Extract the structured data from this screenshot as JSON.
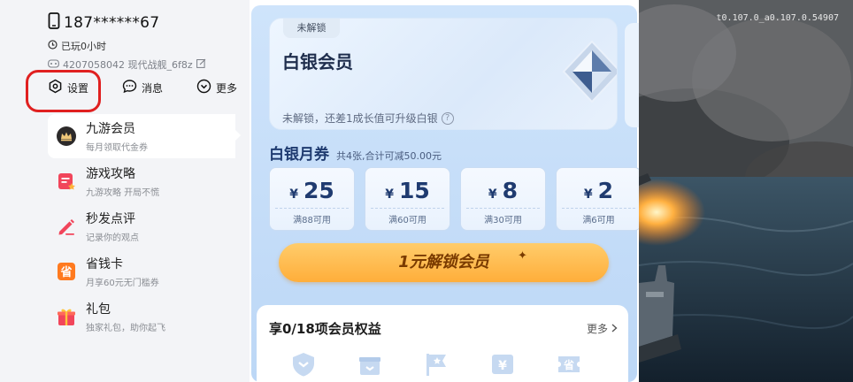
{
  "user": {
    "phone": "187******67",
    "played": "已玩0小时",
    "id_text": "4207058042  现代战舰_6f8z"
  },
  "actions": {
    "settings": "设置",
    "messages": "消息",
    "more": "更多"
  },
  "menu": [
    {
      "title": "九游会员",
      "sub": "每月领取代金券",
      "icon": "crown-icon"
    },
    {
      "title": "游戏攻略",
      "sub": "九游攻略 开局不慌",
      "icon": "guide-icon"
    },
    {
      "title": "秒发点评",
      "sub": "记录你的观点",
      "icon": "pen-icon"
    },
    {
      "title": "省钱卡",
      "sub": "月享60元无门槛券",
      "icon": "saving-card-icon"
    },
    {
      "title": "礼包",
      "sub": "独家礼包，助你起飞",
      "icon": "gift-icon"
    }
  ],
  "membership": {
    "locked_tag": "未解锁",
    "level_name": "白银会员",
    "note": "未解锁，还差1成长值可升级白银",
    "coupon_title": "白银月券",
    "coupon_sub": "共4张,合计可减50.00元",
    "coupons": [
      {
        "currency": "¥",
        "amount": "25",
        "cond": "满88可用"
      },
      {
        "currency": "¥",
        "amount": "15",
        "cond": "满60可用"
      },
      {
        "currency": "¥",
        "amount": "8",
        "cond": "满30可用"
      },
      {
        "currency": "¥",
        "amount": "2",
        "cond": "满6可用"
      }
    ],
    "unlock_label": "1元解锁会员",
    "benefits_title": "享0/18项会员权益",
    "benefits_more": "更多"
  },
  "game": {
    "version": "t0.107.0_a0.107.0.54907"
  },
  "colors": {
    "highlight_ring": "#e02020",
    "unlock_button": "#ffb547",
    "member_blue": "#1f3b70"
  }
}
